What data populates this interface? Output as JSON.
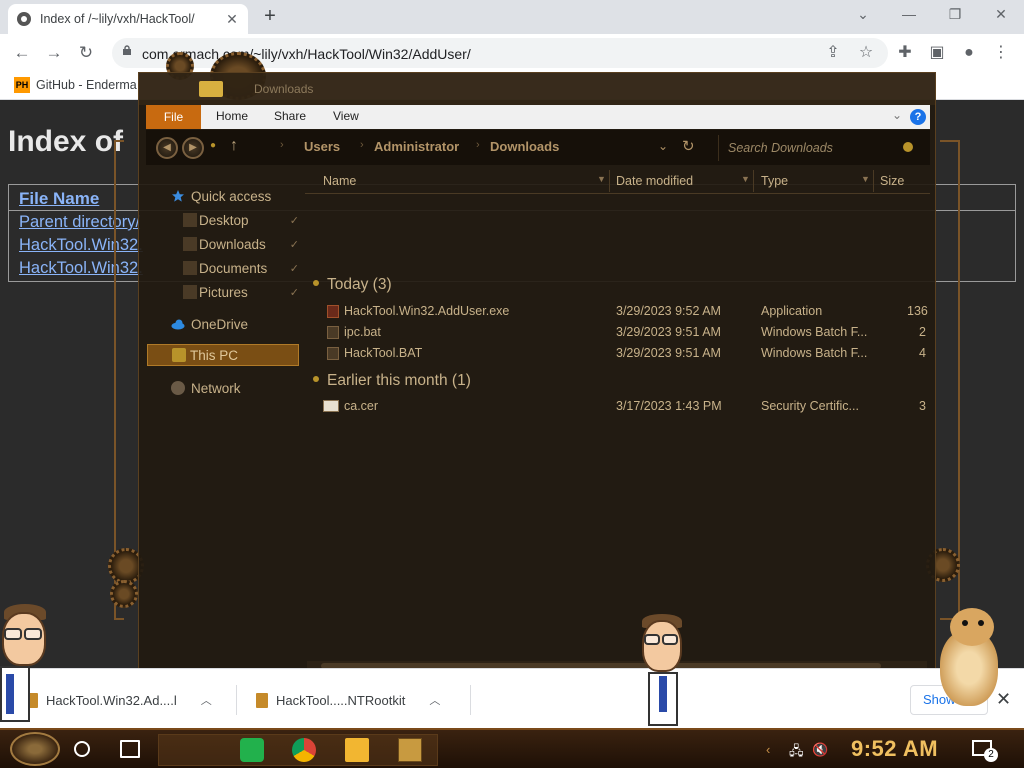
{
  "browser": {
    "tab_title": "Index of /~lily/vxh/HackTool/",
    "url": "com.endermanch.com/~lily/vxh/HackTool/Win32/AddUser/",
    "url_visible": "com                      ermach.com/~lily/vxh/HackTool/Win32/AddUser/",
    "bookmark": "GitHub - Enderma",
    "bookmark_icon": "PH"
  },
  "page": {
    "heading": "Index of",
    "column_header": "File Name",
    "rows": [
      "Parent directory/",
      "HackTool.Win32.",
      "HackTool.Win32."
    ]
  },
  "explorer": {
    "title": "Downloads",
    "ribbon": {
      "file": "File",
      "home": "Home",
      "share": "Share",
      "view": "View",
      "help": "?"
    },
    "breadcrumbs": [
      "Users",
      "Administrator",
      "Downloads"
    ],
    "search_placeholder": "Search Downloads",
    "nav": {
      "quick_access": "Quick access",
      "desktop": "Desktop",
      "downloads": "Downloads",
      "documents": "Documents",
      "pictures": "Pictures",
      "onedrive": "OneDrive",
      "this_pc": "This PC",
      "network": "Network"
    },
    "columns": {
      "name": "Name",
      "date": "Date modified",
      "type": "Type",
      "size": "Size"
    },
    "groups": {
      "today": {
        "label": "Today (3)",
        "files": [
          {
            "name": "HackTool.Win32.AddUser.exe",
            "date": "3/29/2023 9:52 AM",
            "type": "Application",
            "size": "136"
          },
          {
            "name": "ipc.bat",
            "date": "3/29/2023 9:51 AM",
            "type": "Windows Batch F...",
            "size": "2"
          },
          {
            "name": "HackTool.BAT",
            "date": "3/29/2023 9:51 AM",
            "type": "Windows Batch F...",
            "size": "4"
          }
        ]
      },
      "earlier": {
        "label": "Earlier this month (1)",
        "files": [
          {
            "name": "ca.cer",
            "date": "3/17/2023 1:43 PM",
            "type": "Security Certific...",
            "size": "3"
          }
        ]
      }
    }
  },
  "downloads_shelf": {
    "items": [
      "HackTool.Win32.Ad....l",
      "HackTool.....NTRootkit"
    ],
    "show_all": "Show"
  },
  "taskbar": {
    "clock": "9:52 AM",
    "notifications": "2"
  },
  "colors": {
    "accent_orange": "#c86a10",
    "explorer_text": "#c8b28a",
    "link_blue": "#8ab4f8",
    "clock_gold": "#f0c060"
  },
  "icons": [
    "chrome-tab-icon",
    "lock-icon",
    "share-icon",
    "star-icon",
    "extensions-icon",
    "sidepanel-icon",
    "profile-icon",
    "menu-icon",
    "star-quickaccess-icon",
    "cloud-icon",
    "computer-icon",
    "network-icon",
    "search-icon",
    "refresh-icon"
  ]
}
